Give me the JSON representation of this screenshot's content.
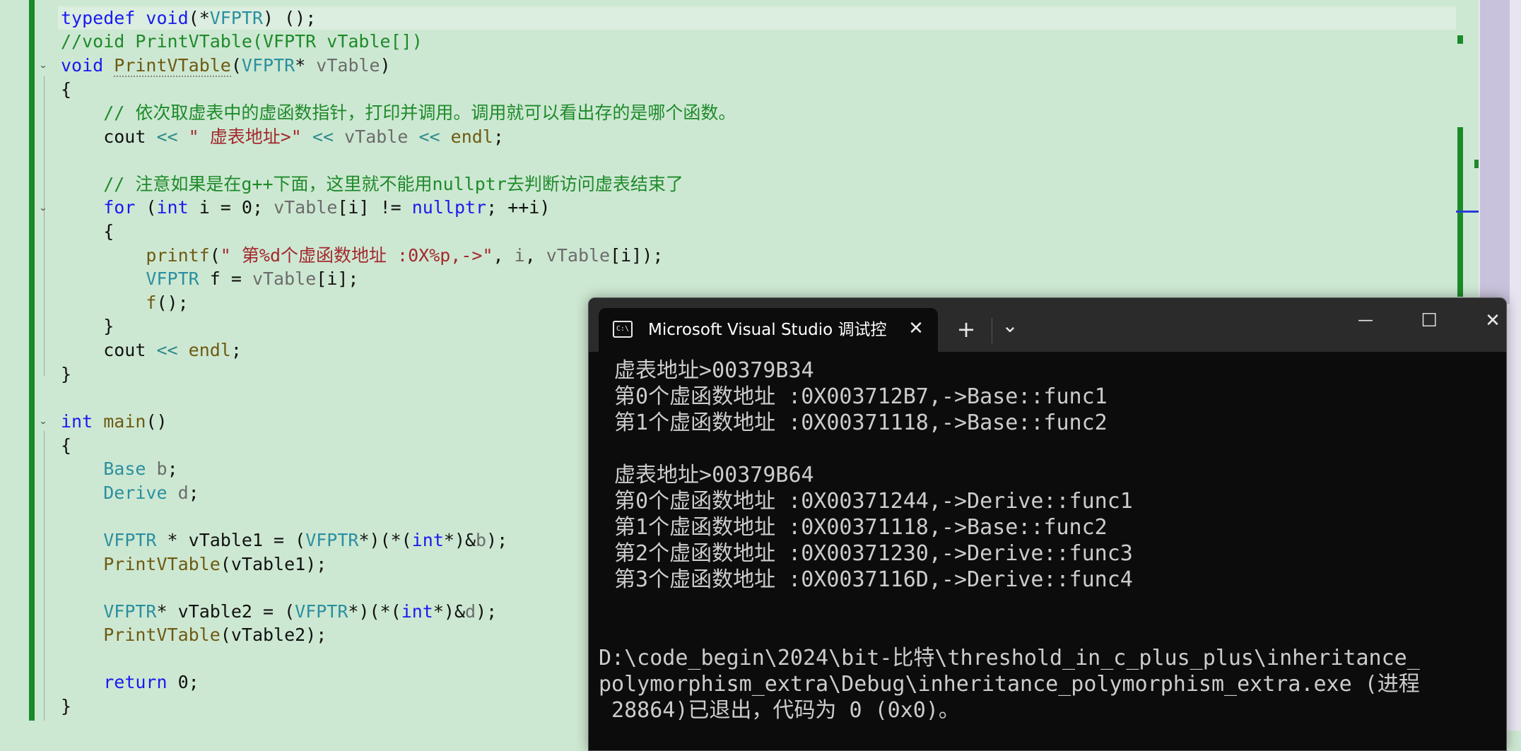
{
  "code": {
    "l1": {
      "a": "typedef",
      "b": " ",
      "c": "void",
      "d": "(*",
      "e": "VFPTR",
      "f": ") ();"
    },
    "l2": {
      "a": "//void PrintVTable(VFPTR vTable[])"
    },
    "l3": {
      "a": "void",
      "b": " ",
      "c": "PrintVTable",
      "d": "(",
      "e": "VFPTR",
      "f": "* ",
      "g": "vTable",
      "h": ")"
    },
    "l4": {
      "a": "{"
    },
    "l5": {
      "a": "    // 依次取虚表中的虚函数指针，打印并调用。调用就可以看出存的是哪个函数。"
    },
    "l6": {
      "a": "    cout ",
      "b": "<<",
      "c": " ",
      "d": "\" 虚表地址>\"",
      "e": " ",
      "f": "<<",
      "g": " ",
      "h": "vTable",
      "i": " ",
      "j": "<<",
      "k": " ",
      "l": "endl",
      "m": ";"
    },
    "l8": {
      "a": "    // 注意如果是在g++下面，这里就不能用nullptr去判断访问虚表结束了"
    },
    "l9": {
      "a": "    ",
      "b": "for",
      "c": " (",
      "d": "int",
      "e": " i = 0; ",
      "f": "vTable",
      "g": "[i] != ",
      "h": "nullptr",
      "i": "; ++i)"
    },
    "l10": {
      "a": "    {"
    },
    "l11": {
      "a": "        ",
      "b": "printf",
      "c": "(",
      "d": "\" 第%d个虚函数地址 :0X%p,->\"",
      "e": ", ",
      "f": "i",
      "g": ", ",
      "h": "vTable",
      "i": "[i]);"
    },
    "l12": {
      "a": "        ",
      "b": "VFPTR",
      "c": " f = ",
      "d": "vTable",
      "e": "[i];"
    },
    "l13": {
      "a": "        ",
      "b": "f",
      "c": "();"
    },
    "l14": {
      "a": "    }"
    },
    "l15": {
      "a": "    cout ",
      "b": "<<",
      "c": " ",
      "d": "endl",
      "e": ";"
    },
    "l16": {
      "a": "}"
    },
    "l18": {
      "a": "int",
      "b": " ",
      "c": "main",
      "d": "()"
    },
    "l19": {
      "a": "{"
    },
    "l20": {
      "a": "    ",
      "b": "Base",
      "c": " ",
      "d": "b",
      "e": ";"
    },
    "l21": {
      "a": "    ",
      "b": "Derive",
      "c": " ",
      "d": "d",
      "e": ";"
    },
    "l23": {
      "a": "    ",
      "b": "VFPTR",
      "c": " * vTable1 = (",
      "d": "VFPTR",
      "e": "*)(*(",
      "f": "int",
      "g": "*)&",
      "h": "b",
      "i": ");"
    },
    "l24": {
      "a": "    ",
      "b": "PrintVTable",
      "c": "(vTable1);"
    },
    "l26": {
      "a": "    ",
      "b": "VFPTR",
      "c": "* vTable2 = (",
      "d": "VFPTR",
      "e": "*)(*(",
      "f": "int",
      "g": "*)&",
      "h": "d",
      "i": ");"
    },
    "l27": {
      "a": "    ",
      "b": "PrintVTable",
      "c": "(vTable2);"
    },
    "l29": {
      "a": "    ",
      "b": "return",
      "c": " 0;"
    },
    "l30": {
      "a": "}"
    }
  },
  "terminal": {
    "tab_title": "Microsoft Visual Studio 调试控",
    "tab_icon_text": "C:\\",
    "close_tab": "✕",
    "new_tab": "+",
    "dropdown": "⌄",
    "minimize": "—",
    "maximize": "☐",
    "close": "✕",
    "lines": [
      " 虚表地址>00379B34",
      " 第0个虚函数地址 :0X003712B7,->Base::func1",
      " 第1个虚函数地址 :0X00371118,->Base::func2",
      " 虚表地址>00379B64",
      " 第0个虚函数地址 :0X00371244,->Derive::func1",
      " 第1个虚函数地址 :0X00371118,->Base::func2",
      " 第2个虚函数地址 :0X00371230,->Derive::func3",
      " 第3个虚函数地址 :0X0037116D,->Derive::func4",
      "D:\\code_begin\\2024\\bit-比特\\threshold_in_c_plus_plus\\inheritance_",
      "polymorphism_extra\\Debug\\inheritance_polymorphism_extra.exe (进程",
      " 28864)已退出，代码为 0 (0x0)。"
    ]
  }
}
